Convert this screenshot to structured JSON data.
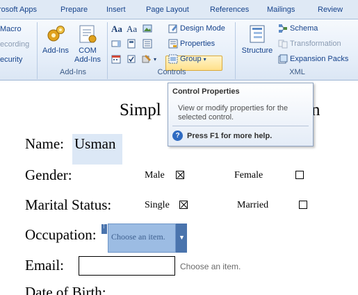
{
  "tabs": [
    "rosoft Apps",
    "Prepare",
    "Insert",
    "Page Layout",
    "References",
    "Mailings",
    "Review"
  ],
  "code_group": {
    "macro": "Macro",
    "recording": "ecording",
    "security": "ecurity"
  },
  "addins_group": {
    "label": "Add-Ins",
    "addins": "Add-Ins",
    "com_addins_line1": "COM",
    "com_addins_line2": "Add-Ins"
  },
  "controls_group": {
    "label": "Controls",
    "design_mode": "Design Mode",
    "properties": "Properties",
    "group": "Group"
  },
  "xml_group": {
    "label": "XML",
    "structure": "Structure",
    "schema": "Schema",
    "transformation": "Transformation",
    "expansion_packs": "Expansion Packs"
  },
  "tooltip": {
    "title": "Control Properties",
    "description": "View or modify properties for the selected control.",
    "help": "Press F1 for more help."
  },
  "document": {
    "title_start": "Simpl",
    "title_end": "n",
    "name_label": "Name:",
    "name_value": "Usman",
    "gender_label": "Gender:",
    "male": "Male",
    "female": "Female",
    "marital_label": "Marital Status:",
    "single": "Single",
    "married": "Married",
    "occupation_label": "Occupation:",
    "occupation_placeholder": "Choose an item.",
    "email_label": "Email:",
    "email_hint": "Choose an item.",
    "dob_label": "Date of Birth:"
  },
  "checkboxes": {
    "male": true,
    "female": false,
    "single": true,
    "married": false
  },
  "colors": {
    "ribbon_bg": "#e8f0fa",
    "accent": "#15428b",
    "highlight": "#ffe08a",
    "dropdown": "#9cbce3",
    "dropdown_btn": "#4a74ad"
  }
}
